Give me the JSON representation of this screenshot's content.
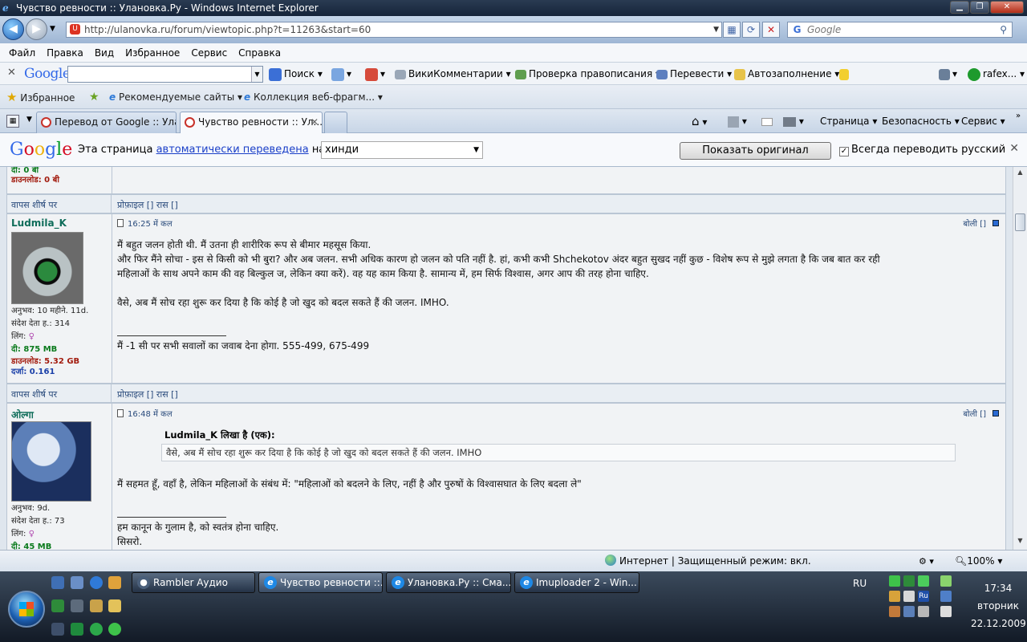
{
  "window": {
    "title": "Чувство ревности :: Улановка.Ру - Windows Internet Explorer"
  },
  "address": {
    "url": "http://ulanovka.ru/forum/viewtopic.php?t=11263&start=60"
  },
  "search": {
    "placeholder": "Google"
  },
  "menu": [
    "Файл",
    "Правка",
    "Вид",
    "Избранное",
    "Сервис",
    "Справка"
  ],
  "google_toolbar": {
    "logo": "Google",
    "search": "Поиск",
    "wiki": "ВикиКомментарии",
    "spell": "Проверка правописания",
    "translate": "Перевести",
    "autofill": "Автозаполнение",
    "user": "rafex..."
  },
  "favorites": {
    "label": "Избранное",
    "recommended": "Рекомендуемые сайты",
    "gallery": "Коллекция веб-фрагм..."
  },
  "tabs": [
    {
      "label": "Перевод от Google :: Ула..."
    },
    {
      "label": "Чувство ревности :: Ул..."
    }
  ],
  "commands": {
    "page": "Страница",
    "safety": "Безопасность",
    "tools": "Сервис"
  },
  "translate_bar": {
    "logo": "Google",
    "text_before": "Эта страница",
    "link": "автоматически переведена",
    "text_after": "на",
    "language": "хинди",
    "show_original": "Показать оригинал",
    "always": "Всегда переводить русский"
  },
  "forum": {
    "top_stats": {
      "up": "दी: 0 बी",
      "down": "डाउनलोड: 0 बी"
    },
    "back_to_top": "वापस शीर्ष पर",
    "profile_links": "प्रोफ़ाइल  []  रास  []",
    "reply": "बोली  []",
    "posts": [
      {
        "author": "Ludmila_K",
        "time": "16:25 में कल",
        "info": [
          "अनुभव: 10 महीने. 11d.",
          "संदेश देता ह.: 314",
          "लिंग:"
        ],
        "up": "दी: 875 MB",
        "down": "डाउनलोड: 5.32 GB",
        "rank": "दर्जा: 0.161",
        "lines": [
          "मैं बहुत जलन होती थी. मैं उतना ही शारीरिक रूप से बीमार महसूस किया.",
          "और फिर मैंने सोचा - इस से किसी को भी बुरा? और अब जलन. सभी अधिक कारण हो जलन को पति नहीं है. हां, कभी कभी Shchekotov अंदर बहुत सुखद नहीं कुछ - विशेष रूप से मुझे लगता है कि जब बात कर रही",
          "महिलाओं के साथ अपने काम की वह बिल्कुल ज, लेकिन क्या करें). वह यह काम किया है. सामान्य में, हम सिर्फ विश्वास, अगर आप की तरह होना चाहिए.",
          "",
          "वैसे, अब मैं सोच रहा शुरू कर दिया है कि कोई है जो खुद को बदल सकते हैं की जलन. IMHO."
        ],
        "signature": "मैं -1 सी पर सभी सवालों का जवाब देना होगा. 555-499, 675-499"
      },
      {
        "author": "ओल्गा",
        "time": "16:48 में कल",
        "info": [
          "अनुभव: 9d.",
          "संदेश देता ह.: 73",
          "लिंग:"
        ],
        "up": "दी: 45 MB",
        "quote_author": "Ludmila_K लिखा है (एक):",
        "quote": "वैसे, अब मैं सोच रहा शुरू कर दिया है कि कोई है जो खुद को बदल सकते हैं की जलन. IMHO",
        "text": "मैं सहमत हूँ, वहाँ है, लेकिन महिलाओं के संबंध में: \"महिलाओं को बदलने के लिए, नहीं है और पुरुषों के विश्वासघात के लिए बदला ले\"",
        "signature1": "हम कानून के गुलाम है, को स्वतंत्र होना चाहिए.",
        "signature2": "सिसरो."
      }
    ]
  },
  "status": {
    "zone": "Интернет | Защищенный режим: вкл.",
    "zoom": "100%"
  },
  "taskbar": {
    "tasks": [
      "Rambler Аудио",
      "Чувство ревности ::...",
      "Улановка.Ру :: Сма...",
      "Imuploader 2 - Win..."
    ],
    "lang": "RU",
    "time": "17:34",
    "day": "вторник",
    "date": "22.12.2009"
  }
}
